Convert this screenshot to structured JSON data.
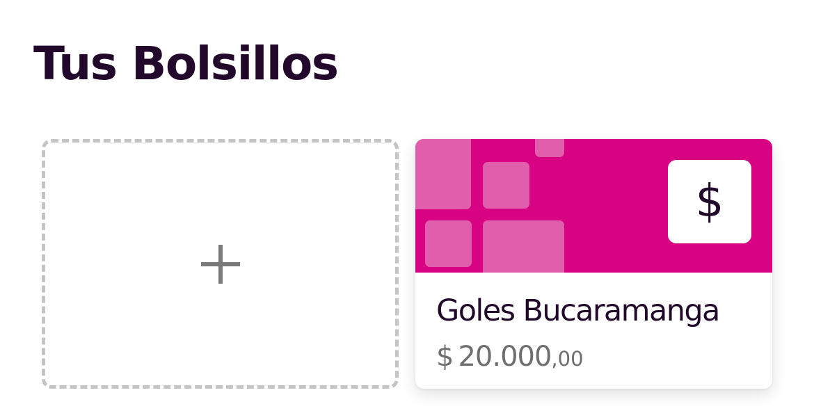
{
  "header": {
    "title": "Tus Bolsillos"
  },
  "add_card": {
    "icon": "plus-icon"
  },
  "pockets": [
    {
      "name": "Goles Bucaramanga",
      "icon": "dollar-icon",
      "icon_glyph": "$",
      "currency_symbol": "$",
      "amount_integer": "20.000",
      "amount_decimal": ",00",
      "banner_color": "#d70382",
      "pattern_color": "#e15ead"
    }
  ],
  "colors": {
    "text_primary": "#22082a",
    "text_secondary": "#6e6e6e",
    "dashed_border": "#c4c4c4"
  }
}
